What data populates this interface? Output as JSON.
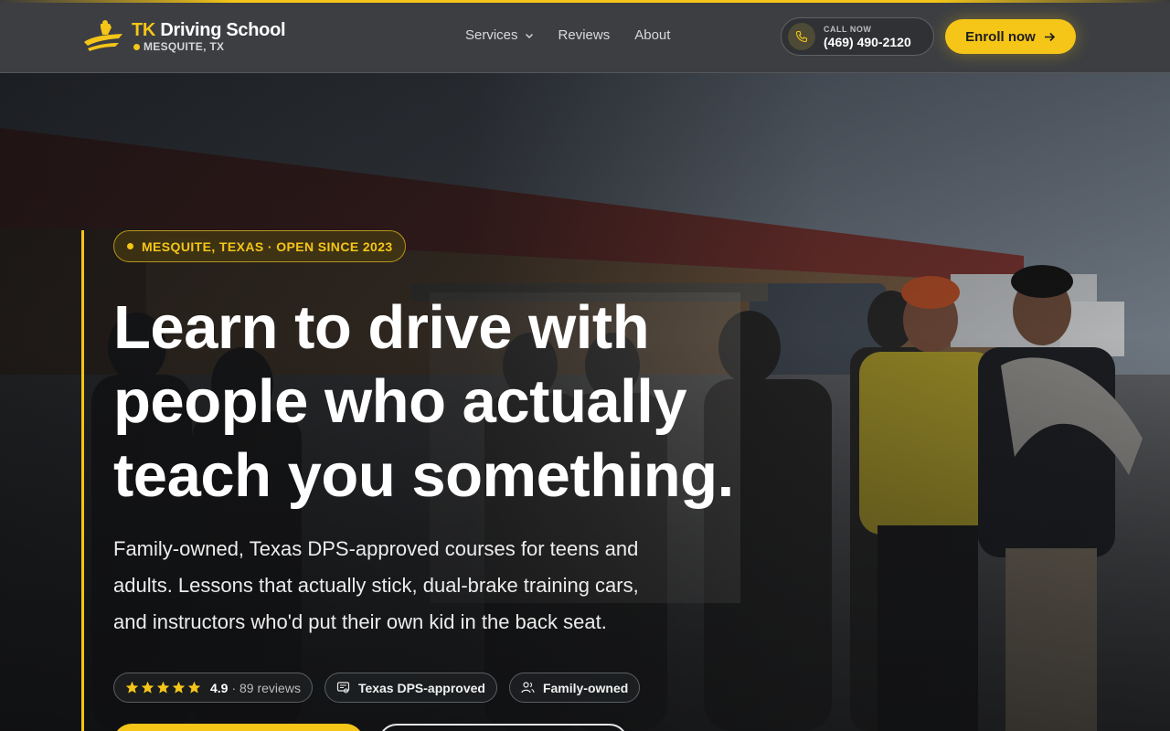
{
  "header": {
    "logo": {
      "brand_prefix": "TK",
      "brand_rest": " Driving School",
      "location": "MESQUITE, TX"
    },
    "nav": [
      {
        "label": "Services",
        "has_dropdown": true
      },
      {
        "label": "Reviews"
      },
      {
        "label": "About"
      }
    ],
    "call": {
      "label": "CALL NOW",
      "number": "(469) 490-2120",
      "icon": "phone-icon"
    },
    "enroll": {
      "label": "Enroll now",
      "icon": "arrow-right-icon"
    }
  },
  "hero": {
    "badge": "MESQUITE, TEXAS · OPEN SINCE 2023",
    "headline_lines": [
      "Learn to drive with",
      "people who actually",
      "teach you something."
    ],
    "subtext": "Family-owned, Texas DPS-approved courses for teens and adults. Lessons that actually stick, dual-brake training cars, and instructors who'd put their own kid in the back seat.",
    "rating": {
      "stars": 5,
      "score": "4.9",
      "reviews": "· 89 reviews"
    },
    "chips": [
      {
        "label": "Texas DPS-approved",
        "icon": "certificate-icon"
      },
      {
        "label": "Family-owned",
        "icon": "people-icon"
      }
    ]
  },
  "colors": {
    "accent": "#f5c518",
    "header_bg": "#3c3e42",
    "text": "#ffffff"
  }
}
